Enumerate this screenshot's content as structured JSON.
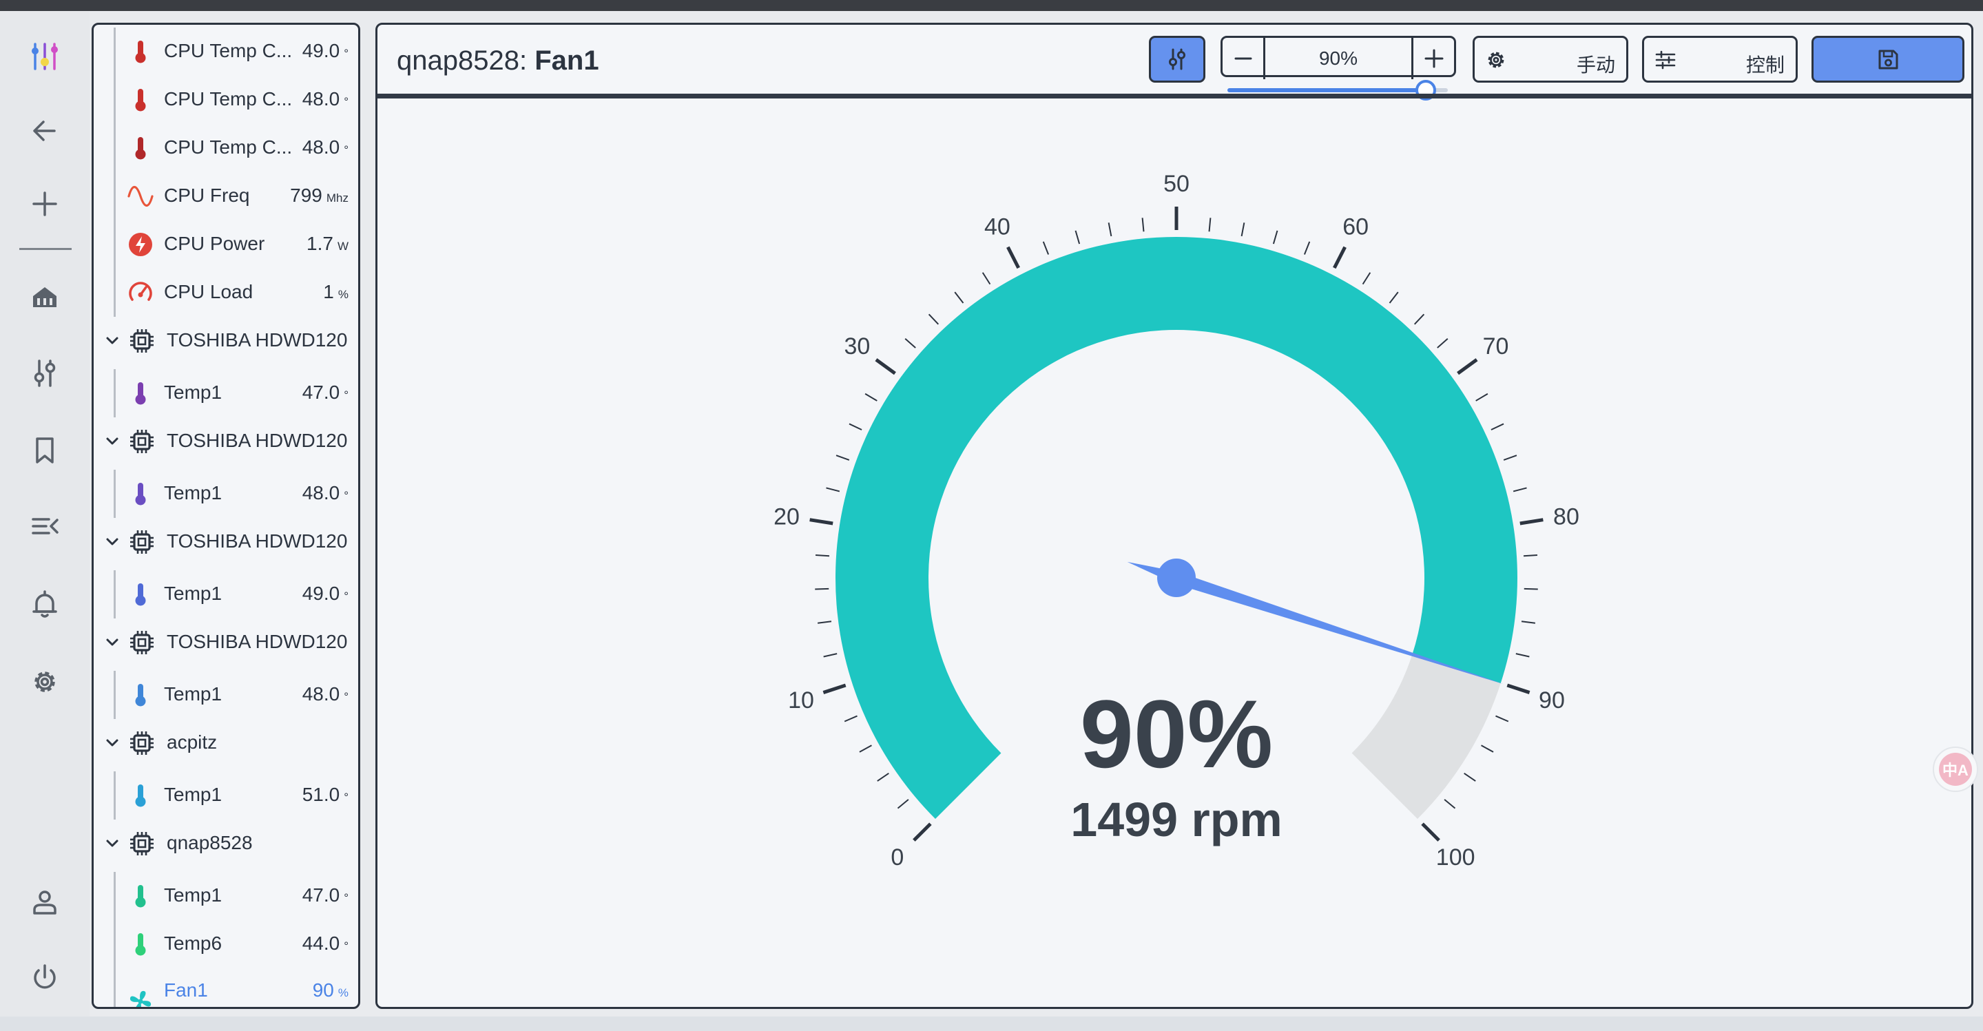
{
  "rail": {
    "items": [
      {
        "id": "logo",
        "icon": "sliders-logo-icon"
      },
      {
        "id": "back",
        "icon": "arrow-left-icon"
      },
      {
        "id": "add",
        "icon": "plus-icon"
      },
      {
        "id": "home",
        "icon": "home-icon"
      },
      {
        "id": "tune",
        "icon": "tune-icon"
      },
      {
        "id": "bookmark",
        "icon": "bookmark-icon"
      },
      {
        "id": "menu",
        "icon": "menu-collapse-icon"
      },
      {
        "id": "bell",
        "icon": "bell-icon"
      },
      {
        "id": "settings",
        "icon": "gear-icon"
      },
      {
        "id": "user",
        "icon": "user-icon"
      },
      {
        "id": "power",
        "icon": "power-icon"
      }
    ]
  },
  "sensors": [
    {
      "kind": "item",
      "icon": "thermometer-icon",
      "icon_color": "#c9302c",
      "name": "CPU Temp C...",
      "value": "49.0",
      "unit": "°"
    },
    {
      "kind": "item",
      "icon": "thermometer-icon",
      "icon_color": "#c9302c",
      "name": "CPU Temp C...",
      "value": "48.0",
      "unit": "°"
    },
    {
      "kind": "item",
      "icon": "thermometer-icon",
      "icon_color": "#b0282a",
      "name": "CPU Temp C...",
      "value": "48.0",
      "unit": "°"
    },
    {
      "kind": "item",
      "icon": "sine-wave-icon",
      "icon_color": "#e8553a",
      "name": "CPU Freq",
      "value": "799",
      "unit": "Mhz"
    },
    {
      "kind": "item",
      "icon": "bolt-icon",
      "icon_color": "#e0443a",
      "name": "CPU Power",
      "value": "1.7",
      "unit": "W"
    },
    {
      "kind": "item",
      "icon": "speedometer-icon",
      "icon_color": "#e0443a",
      "name": "CPU Load",
      "value": "1",
      "unit": "%"
    },
    {
      "kind": "group",
      "name": "TOSHIBA HDWD120"
    },
    {
      "kind": "item",
      "icon": "thermometer-icon",
      "icon_color": "#7b3fb0",
      "name": "Temp1",
      "value": "47.0",
      "unit": "°"
    },
    {
      "kind": "group",
      "name": "TOSHIBA HDWD120"
    },
    {
      "kind": "item",
      "icon": "thermometer-icon",
      "icon_color": "#6a4ec2",
      "name": "Temp1",
      "value": "48.0",
      "unit": "°"
    },
    {
      "kind": "group",
      "name": "TOSHIBA HDWD120"
    },
    {
      "kind": "item",
      "icon": "thermometer-icon",
      "icon_color": "#4f6ad6",
      "name": "Temp1",
      "value": "49.0",
      "unit": "°"
    },
    {
      "kind": "group",
      "name": "TOSHIBA HDWD120"
    },
    {
      "kind": "item",
      "icon": "thermometer-icon",
      "icon_color": "#3f86d8",
      "name": "Temp1",
      "value": "48.0",
      "unit": "°"
    },
    {
      "kind": "group",
      "name": "acpitz"
    },
    {
      "kind": "item",
      "icon": "thermometer-icon",
      "icon_color": "#2aa0d6",
      "name": "Temp1",
      "value": "51.0",
      "unit": "°"
    },
    {
      "kind": "group",
      "name": "qnap8528"
    },
    {
      "kind": "item",
      "icon": "thermometer-icon",
      "icon_color": "#22c08e",
      "name": "Temp1",
      "value": "47.0",
      "unit": "°"
    },
    {
      "kind": "item",
      "icon": "thermometer-icon",
      "icon_color": "#2ed07a",
      "name": "Temp6",
      "value": "44.0",
      "unit": "°"
    },
    {
      "kind": "fan",
      "icon": "fan-icon",
      "icon_color": "#1fc3c3",
      "name": "Fan1",
      "value": "90",
      "unit": "%",
      "sub_name": "90%",
      "sub_value": "1499",
      "sub_unit": "rpm"
    }
  ],
  "header": {
    "device": "qnap8528: ",
    "sensor": "Fan1"
  },
  "toolbar": {
    "curve_icon": "tune-icon",
    "stepper": {
      "value": "90%",
      "minus_icon": "minus-icon",
      "plus_icon": "plus-icon",
      "level": 0.9
    },
    "mode_icon": "gear-icon",
    "mode_label": "手动",
    "control_icon": "sliders-icon",
    "control_label": "控制",
    "save_icon": "save-icon"
  },
  "gauge": {
    "min": 0,
    "max": 100,
    "value": 90,
    "value_text": "90%",
    "sub_text": "1499 rpm",
    "tick_labels": [
      "0",
      "10",
      "20",
      "30",
      "40",
      "50",
      "60",
      "70",
      "80",
      "90",
      "100"
    ],
    "colors": {
      "fill": "#1ec6c2",
      "track": "#dfe1e3",
      "needle": "#5f8eef",
      "text": "#3a424c"
    }
  },
  "bubble": {
    "text": "中A"
  }
}
